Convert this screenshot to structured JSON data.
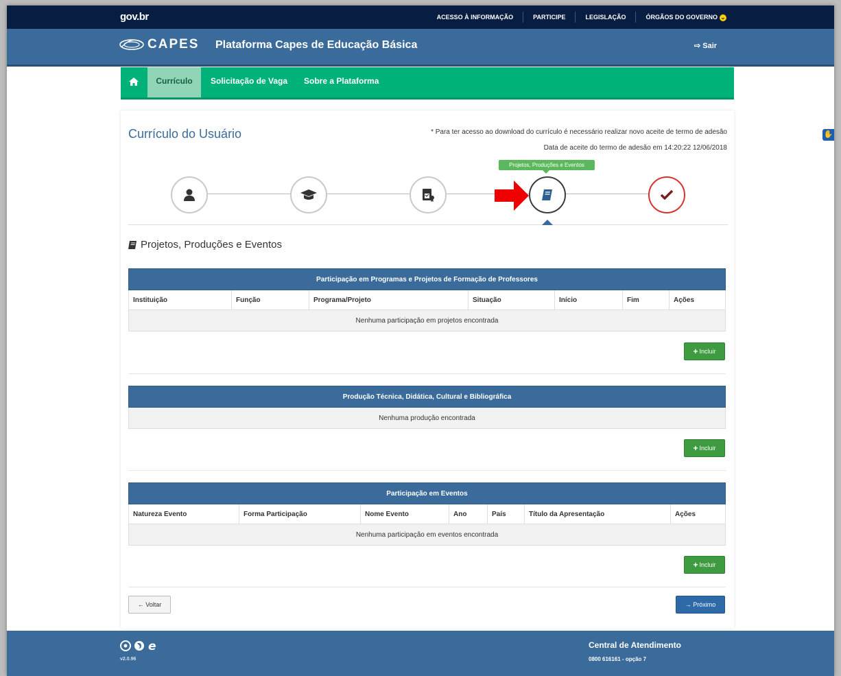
{
  "gov": {
    "logo": "gov.br",
    "links": [
      "ACESSO À INFORMAÇÃO",
      "PARTICIPE",
      "LEGISLAÇÃO",
      "ÓRGÃOS DO GOVERNO"
    ]
  },
  "header": {
    "brand": "CAPES",
    "platform": "Plataforma Capes de Educação Básica",
    "logout": "Sair"
  },
  "nav": {
    "items": [
      "Currículo",
      "Solicitação de Vaga",
      "Sobre a Plataforma"
    ],
    "active": "Currículo"
  },
  "card": {
    "title": "Currículo do Usuário",
    "note1": "* Para ter acesso ao download do currículo é necessário realizar novo aceite de termo de adesão",
    "note2": "Data de aceite do termo de adesão em 14:20:22 12/06/2018",
    "tooltip": "Projetos, Produções e Eventos",
    "steps": [
      "user-icon",
      "graduation-cap-icon",
      "certificate-icon",
      "book-icon",
      "check-icon"
    ],
    "section_title": "Projetos, Produções e Eventos"
  },
  "tables": [
    {
      "caption": "Participação em Programas e Projetos de Formação de Professores",
      "columns": [
        "Instituição",
        "Função",
        "Programa/Projeto",
        "Situação",
        "Início",
        "Fim",
        "Ações"
      ],
      "empty": "Nenhuma participação em projetos encontrada",
      "button": "Incluir"
    },
    {
      "caption": "Produção Técnica, Didática, Cultural e Bibliográfica",
      "columns": [],
      "empty": "Nenhuma produção encontrada",
      "button": "Incluir"
    },
    {
      "caption": "Participação em Eventos",
      "columns": [
        "Natureza Evento",
        "Forma Participação",
        "Nome Evento",
        "Ano",
        "País",
        "Título da Apresentação",
        "Ações"
      ],
      "empty": "Nenhuma participação em eventos encontrada",
      "button": "Incluir"
    }
  ],
  "buttons": {
    "back": "Voltar",
    "next": "Próximo"
  },
  "footer": {
    "version": "v2.0.96",
    "central": "Central de Atendimento",
    "phone": "0800 616161 - opção 7"
  },
  "colors": {
    "gov_bar": "#071d41",
    "capes_blue": "#3a6b9b",
    "nav_green": "#00b27a",
    "include_green": "#3f9b3f",
    "arrow_red": "#ee0000"
  }
}
